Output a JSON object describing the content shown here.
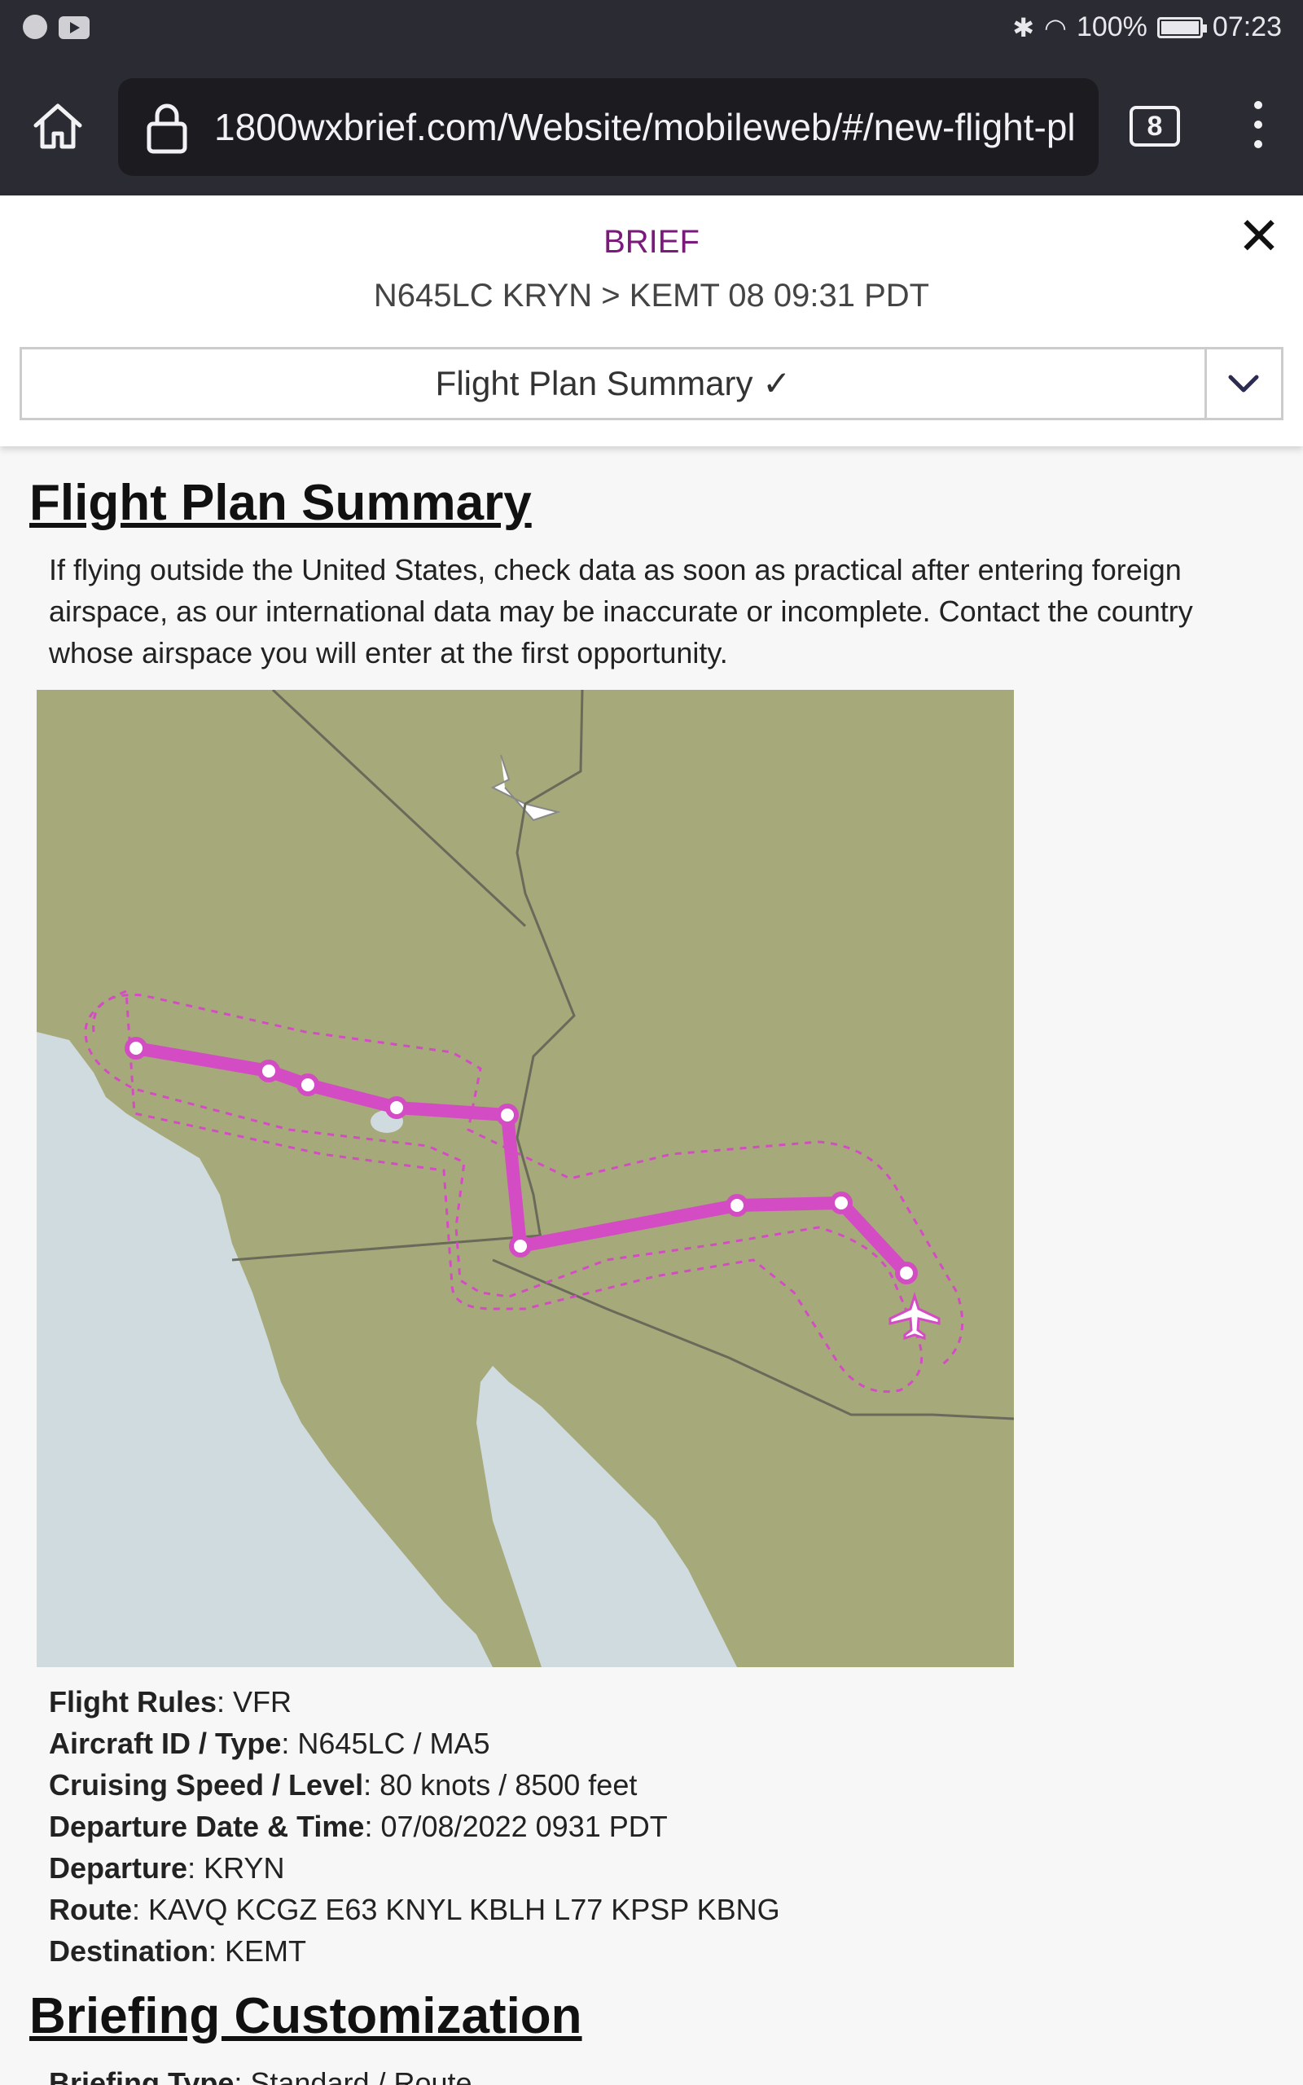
{
  "status_bar": {
    "battery": "100%",
    "time": "07:23"
  },
  "browser": {
    "url": "1800wxbrief.com/Website/mobileweb/#/new-flight-pl",
    "tab_count": "8"
  },
  "header": {
    "title": "BRIEF",
    "subtitle": "N645LC KRYN > KEMT 08 09:31 PDT",
    "section_select": "Flight Plan Summary ✓"
  },
  "main": {
    "heading": "Flight Plan Summary",
    "intro": "If flying outside the United States, check data as soon as practical after entering foreign airspace, as our international data may be inaccurate or incomplete. Contact the country whose airspace you will enter at the first opportunity.",
    "details": [
      {
        "label": "Flight Rules",
        "value": ": VFR"
      },
      {
        "label": "Aircraft ID / Type",
        "value": ": N645LC / MA5"
      },
      {
        "label": "Cruising Speed / Level",
        "value": ": 80 knots / 8500 feet"
      },
      {
        "label": "Departure Date & Time",
        "value": ": 07/08/2022 0931 PDT"
      },
      {
        "label": "Departure",
        "value": ": KRYN"
      },
      {
        "label": "Route",
        "value": ": KAVQ KCGZ E63 KNYL KBLH L77 KPSP KBNG"
      },
      {
        "label": "Destination",
        "value": ": KEMT"
      }
    ],
    "heading2": "Briefing Customization",
    "partial_label": "Briefing Type",
    "partial_value": ": Standard / Route"
  },
  "map": {
    "land_color": "#a6a97a",
    "water_color": "#d0dbe0",
    "route_color": "#d44cc4",
    "route_points": 10
  }
}
